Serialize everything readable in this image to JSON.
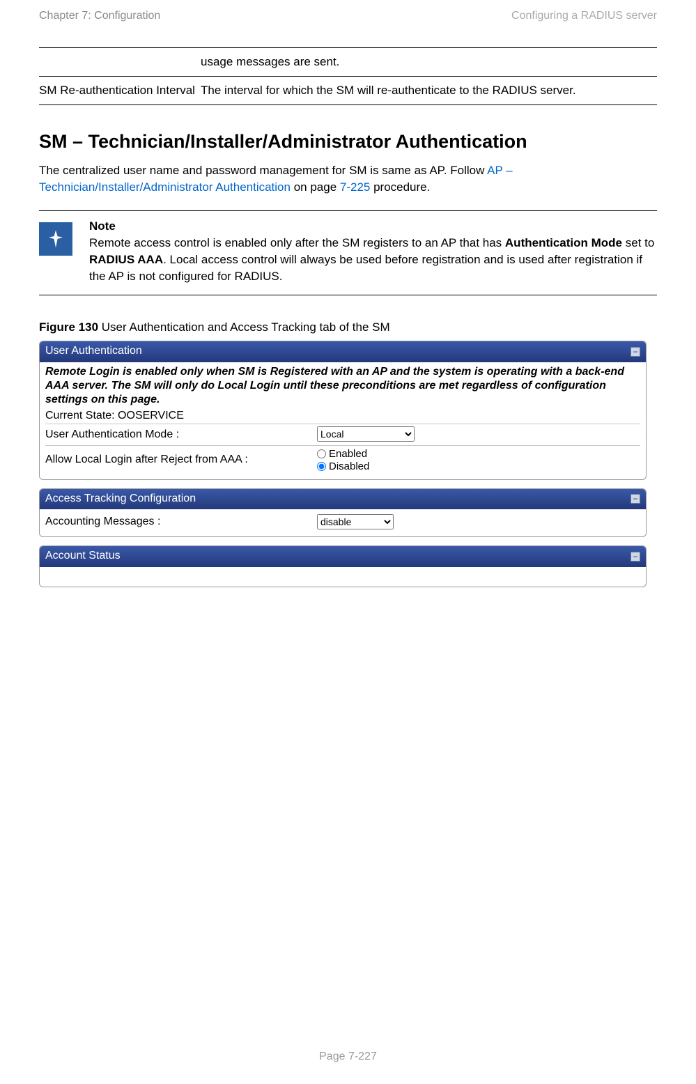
{
  "header": {
    "left": "Chapter 7:  Configuration",
    "right": "Configuring a RADIUS server"
  },
  "table_rows": [
    {
      "c1": "",
      "c2": "usage messages are sent."
    },
    {
      "c1": "SM Re-authentication Interval",
      "c2": "The interval for which the SM will re-authenticate to the RADIUS server."
    }
  ],
  "section": {
    "title": "SM – Technician/Installer/Administrator Authentication",
    "intro_pre": "The centralized user name and password management for SM is same as AP. Follow ",
    "intro_link": "AP – Technician/Installer/Administrator Authentication",
    "intro_mid": " on page ",
    "intro_pageref": "7-225",
    "intro_post": " procedure."
  },
  "note": {
    "label": "Note",
    "pre": "Remote access control is enabled only after the SM registers to an AP that has ",
    "b1": "Authentication Mode",
    "mid1": " set to ",
    "b2": "RADIUS AAA",
    "post": ". Local access control will always be used before registration and is used after registration if the AP is not configured for RADIUS."
  },
  "figure": {
    "label_bold": "Figure 130",
    "label_rest": " User Authentication and Access Tracking tab of the SM"
  },
  "panel1": {
    "title": "User Authentication",
    "italic1": "Remote Login is enabled only when SM is Registered with an AP and the system is operating with a back-end AAA server. The SM will only do Local Login until these preconditions are met regardless of configuration settings on this page.",
    "state": "Current State: OOSERVICE",
    "row1_label": "User Authentication Mode :",
    "row1_value": "Local",
    "row2_label": "Allow Local Login after Reject from AAA :",
    "row2_opt1": "Enabled",
    "row2_opt2": "Disabled"
  },
  "panel2": {
    "title": "Access Tracking Configuration",
    "row1_label": "Accounting Messages :",
    "row1_value": "disable"
  },
  "panel3": {
    "title": "Account Status"
  },
  "footer": "Page 7-227"
}
